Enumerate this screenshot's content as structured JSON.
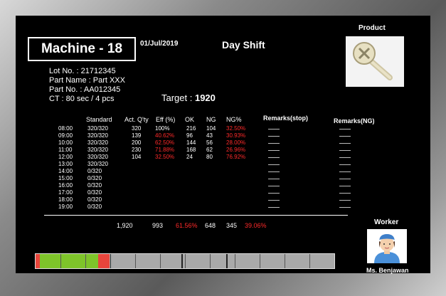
{
  "machine_label": "Machine -  18",
  "date": "01/Jul/2019",
  "shift": "Day Shift",
  "product_label": "Product",
  "lot_no": "Lot No. : 21712345",
  "part_name": "Part Name :  Part XXX",
  "part_no": "Part No. : AA012345",
  "ct": "CT : 80 sec / 4 pcs",
  "target_label": "Target : ",
  "target_value": "1920",
  "headers": {
    "standard": "Standard",
    "actual": "Act. Q'ty",
    "eff": "Eff (%)",
    "ok": "OK",
    "ng": "NG",
    "ngpct": "NG%",
    "remarks_stop": "Remarks(stop)",
    "remarks_ng": "Remarks(NG)"
  },
  "rows": [
    {
      "time": "08:00",
      "standard": "320/320",
      "actual": "320",
      "eff": "100%",
      "eff_red": false,
      "ok": "216",
      "ng": "104",
      "ngpct": "32.50%",
      "ngpct_red": true
    },
    {
      "time": "09:00",
      "standard": "320/320",
      "actual": "139",
      "eff": "40.62%",
      "eff_red": true,
      "ok": "96",
      "ng": "43",
      "ngpct": "30.93%",
      "ngpct_red": true
    },
    {
      "time": "10:00",
      "standard": "320/320",
      "actual": "200",
      "eff": "62.50%",
      "eff_red": true,
      "ok": "144",
      "ng": "56",
      "ngpct": "28.00%",
      "ngpct_red": true
    },
    {
      "time": "11:00",
      "standard": "320/320",
      "actual": "230",
      "eff": "71.88%",
      "eff_red": true,
      "ok": "168",
      "ng": "62",
      "ngpct": "26.96%",
      "ngpct_red": true
    },
    {
      "time": "12:00",
      "standard": "320/320",
      "actual": "104",
      "eff": "32.50%",
      "eff_red": true,
      "ok": "24",
      "ng": "80",
      "ngpct": "76.92%",
      "ngpct_red": true
    },
    {
      "time": "13:00",
      "standard": "320/320",
      "actual": "",
      "eff": "",
      "eff_red": false,
      "ok": "",
      "ng": "",
      "ngpct": "",
      "ngpct_red": false
    },
    {
      "time": "14:00",
      "standard": "0/320",
      "actual": "",
      "eff": "",
      "eff_red": false,
      "ok": "",
      "ng": "",
      "ngpct": "",
      "ngpct_red": false
    },
    {
      "time": "15:00",
      "standard": "0/320",
      "actual": "",
      "eff": "",
      "eff_red": false,
      "ok": "",
      "ng": "",
      "ngpct": "",
      "ngpct_red": false
    },
    {
      "time": "16:00",
      "standard": "0/320",
      "actual": "",
      "eff": "",
      "eff_red": false,
      "ok": "",
      "ng": "",
      "ngpct": "",
      "ngpct_red": false
    },
    {
      "time": "17:00",
      "standard": "0/320",
      "actual": "",
      "eff": "",
      "eff_red": false,
      "ok": "",
      "ng": "",
      "ngpct": "",
      "ngpct_red": false
    },
    {
      "time": "18:00",
      "standard": "0/320",
      "actual": "",
      "eff": "",
      "eff_red": false,
      "ok": "",
      "ng": "",
      "ngpct": "",
      "ngpct_red": false
    },
    {
      "time": "19:00",
      "standard": "0/320",
      "actual": "",
      "eff": "",
      "eff_red": false,
      "ok": "",
      "ng": "",
      "ngpct": "",
      "ngpct_red": false
    }
  ],
  "totals": {
    "standard": "1,920",
    "actual": "993",
    "eff": "61.56%",
    "ok": "648",
    "ng": "345",
    "ngpct": "39.06%"
  },
  "worker_label": "Worker",
  "worker_name": "Ms. Benjawan",
  "colors": {
    "screen": "#000000",
    "text": "#ffffff",
    "alert": "#ff2a2a",
    "run": "#7ec42a",
    "stop": "#e8453c",
    "idle": "#a9a9a9"
  },
  "icons": {
    "product": "screw-icon",
    "worker": "worker-avatar-icon"
  }
}
